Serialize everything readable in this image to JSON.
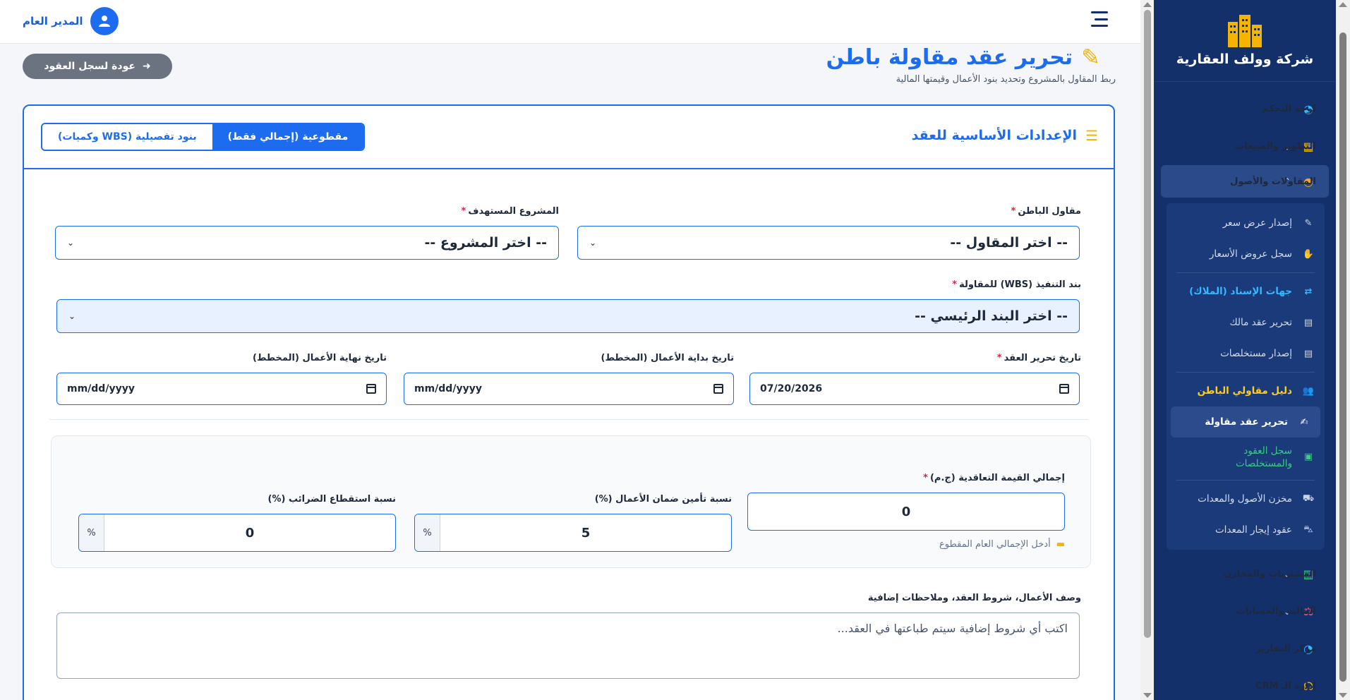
{
  "sidebar": {
    "brand": "شركة وولف العقارية",
    "items": [
      {
        "label": "لوحة التحكم",
        "icon": "dashboard-icon"
      },
      {
        "label": "التطوير والمبيعات",
        "icon": "building-icon"
      },
      {
        "label": "المقاولات والأصول",
        "icon": "hardhat-icon"
      },
      {
        "label": "المشتريات والمخازن",
        "icon": "boxes-icon"
      },
      {
        "label": "المالية والحسابات",
        "icon": "scale-icon"
      },
      {
        "label": "مركز التقارير",
        "icon": "pie-chart-icon"
      },
      {
        "label": "إدارة الـ CRM",
        "icon": "headset-icon"
      }
    ],
    "sub_items": [
      "إصدار عرض سعر",
      "سجل عروض الأسعار",
      "جهات الإسناد (الملاك)",
      "تحرير عقد مالك",
      "إصدار مستخلصات",
      "دليل مقاولي الباطن",
      "تحرير عقد مقاولة",
      "سجل العقود والمستخلصات",
      "مخزن الأصول والمعدات",
      "عقود إيجار المعدات"
    ]
  },
  "topbar": {
    "user_name": "المدير العام"
  },
  "header": {
    "title": "تحرير عقد مقاولة باطن",
    "subtitle": "ربط المقاول بالمشروع وتحديد بنود الأعمال وقيمتها المالية",
    "back_label": "عودة لسجل العقود"
  },
  "card": {
    "title": "الإعدادات الأساسية للعقد",
    "toggle": [
      "مقطوعية (إجمالي فقط)",
      "بنود تفصيلية (WBS وكميات)"
    ]
  },
  "form": {
    "contractor_label": "مقاول الباطن",
    "contractor_value": "-- اختر المقاول --",
    "project_label": "المشروع المستهدف",
    "project_value": "-- اختر المشروع --",
    "wbs_label": "بند التنفيذ (WBS) للمقاولة",
    "wbs_value": "-- اختر البند الرئيسي --",
    "contract_date_label": "تاريخ تحرير العقد",
    "contract_date_value": "07/20/2026",
    "start_date_label": "تاريخ بداية الأعمال (المخطط)",
    "start_date_value": "mm/dd/yyyy",
    "end_date_label": "تاريخ نهاية الأعمال (المخطط)",
    "end_date_value": "mm/dd/yyyy",
    "total_value_label": "إجمالي القيمة التعاقدية (ج.م)",
    "total_value": "0",
    "total_hint": "أدخل الإجمالي العام المقطوع",
    "retention_label": "نسبة تأمين ضمان الأعمال (%)",
    "retention_value": "5",
    "tax_label": "نسبة استقطاع الضرائب (%)",
    "tax_value": "0",
    "percent_unit": "%",
    "notes_label": "وصف الأعمال، شروط العقد، وملاحظات إضافية",
    "notes_placeholder": "اكتب أي شروط إضافية سيتم طباعتها في العقد..."
  }
}
